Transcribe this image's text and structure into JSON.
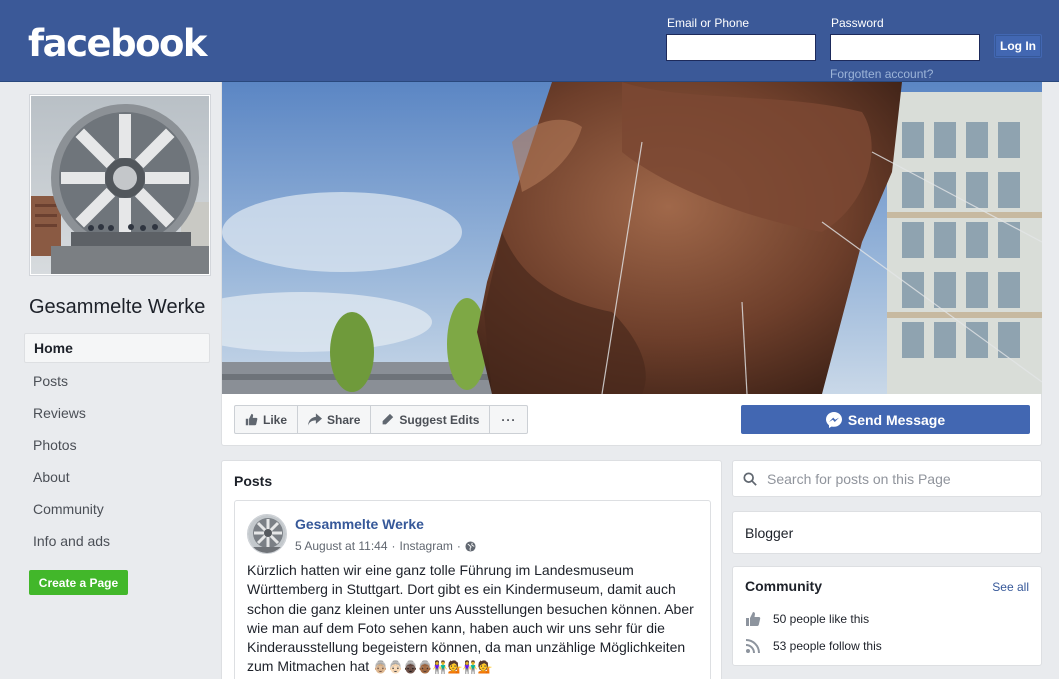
{
  "header": {
    "logo": "facebook",
    "email_label": "Email or Phone",
    "password_label": "Password",
    "login_button": "Log In",
    "forgot_link": "Forgotten account?"
  },
  "page": {
    "name": "Gesammelte Werke"
  },
  "nav": {
    "items": [
      {
        "label": "Home",
        "active": true
      },
      {
        "label": "Posts"
      },
      {
        "label": "Reviews"
      },
      {
        "label": "Photos"
      },
      {
        "label": "About"
      },
      {
        "label": "Community"
      },
      {
        "label": "Info and ads"
      }
    ],
    "create_page": "Create a Page"
  },
  "actions": {
    "like": "Like",
    "share": "Share",
    "suggest_edits": "Suggest Edits",
    "more": "···",
    "send_message": "Send Message"
  },
  "posts": {
    "heading": "Posts",
    "items": [
      {
        "author": "Gesammelte Werke",
        "date": "5 August at 11:44",
        "source": "Instagram",
        "text": "Kürzlich hatten wir eine ganz tolle Führung im Landesmuseum Württemberg in Stuttgart. Dort gibt es ein Kindermuseum, damit auch schon die ganz kleinen unter uns Ausstellungen besuchen können. Aber wie man auf dem Foto sehen kann, haben auch wir uns sehr für die Kinderausstellung begeistern können, da man unzählige Möglichkeiten zum Mitmachen hat",
        "emojis": "👵🏼👵🏻👵🏿👵🏾👫💁👫💁"
      }
    ]
  },
  "sidebar": {
    "search_placeholder": "Search for posts on this Page",
    "category": "Blogger",
    "community": {
      "title": "Community",
      "see_all": "See all",
      "likes": "50 people like this",
      "follows": "53 people follow this"
    }
  },
  "colors": {
    "brand": "#3b5998",
    "button": "#4267b2",
    "create": "#42b72a",
    "link": "#365899"
  }
}
